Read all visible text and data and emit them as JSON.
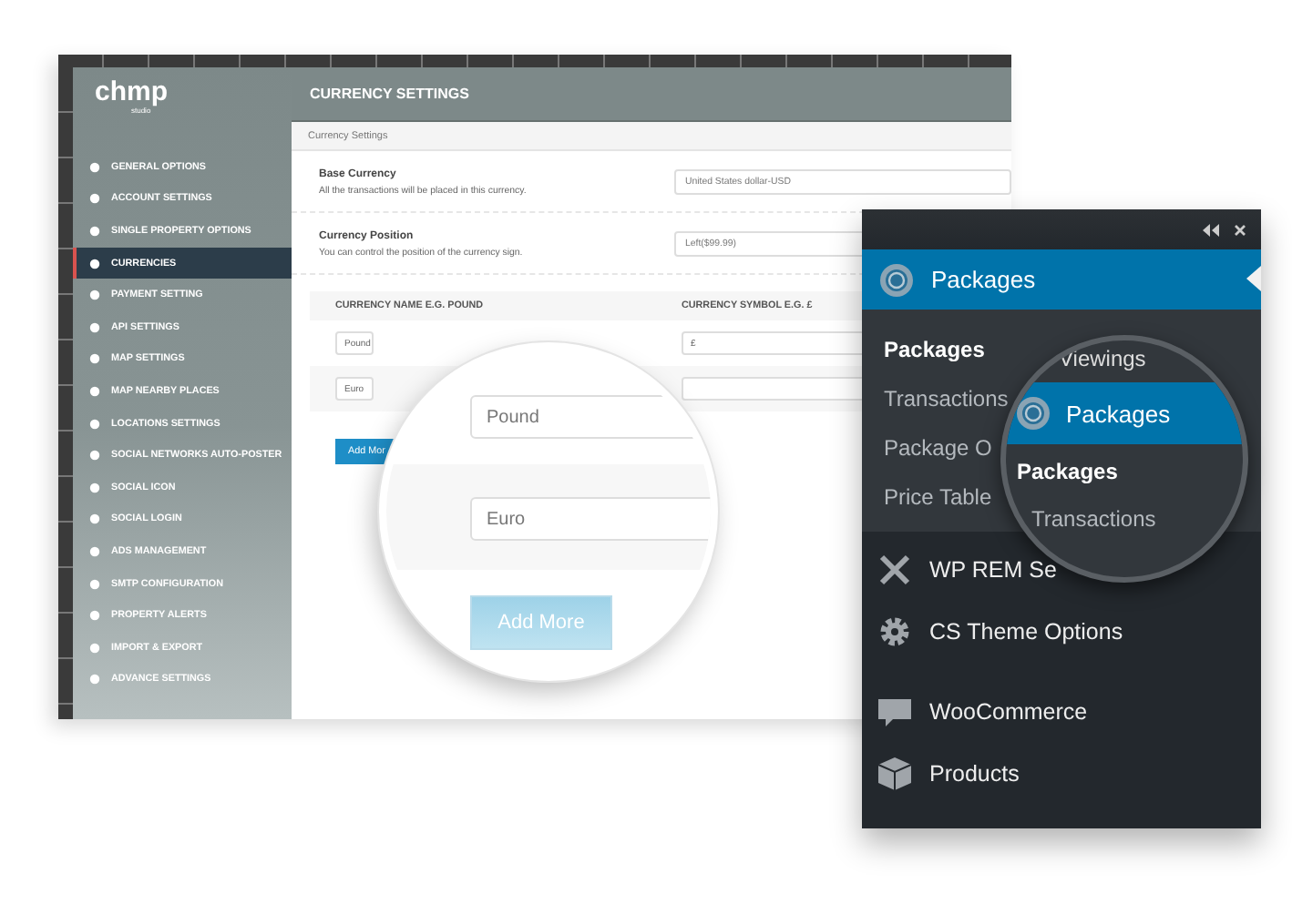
{
  "settings_window": {
    "logo": "chmp",
    "logo_sub": "studio",
    "sidebar": {
      "items": [
        {
          "label": "GENERAL OPTIONS",
          "selected": false
        },
        {
          "label": "ACCOUNT SETTINGS",
          "selected": false
        },
        {
          "label": "SINGLE PROPERTY OPTIONS",
          "selected": false
        },
        {
          "label": "CURRENCIES",
          "selected": true
        },
        {
          "label": "PAYMENT SETTING",
          "selected": false
        },
        {
          "label": "API SETTINGS",
          "selected": false
        },
        {
          "label": "MAP SETTINGS",
          "selected": false
        },
        {
          "label": "MAP NEARBY PLACES",
          "selected": false
        },
        {
          "label": "LOCATIONS SETTINGS",
          "selected": false
        },
        {
          "label": "SOCIAL NETWORKS AUTO-POSTER",
          "selected": false
        },
        {
          "label": "SOCIAL ICON",
          "selected": false
        },
        {
          "label": "SOCIAL LOGIN",
          "selected": false
        },
        {
          "label": "ADS MANAGEMENT",
          "selected": false
        },
        {
          "label": "SMTP CONFIGURATION",
          "selected": false
        },
        {
          "label": "PROPERTY ALERTS",
          "selected": false
        },
        {
          "label": "IMPORT & EXPORT",
          "selected": false
        },
        {
          "label": "ADVANCE SETTINGS",
          "selected": false
        }
      ]
    },
    "header": "CURRENCY SETTINGS",
    "section_tab": "Currency Settings",
    "fields": [
      {
        "label": "Base Currency",
        "description": "All the transactions will be placed in this currency.",
        "value": "United States dollar-USD"
      },
      {
        "label": "Currency Position",
        "description": "You can control the position of the currency sign.",
        "value": "Left($99.99)"
      }
    ],
    "table": {
      "columns": [
        "CURRENCY NAME E.G. POUND",
        "CURRENCY SYMBOL E.G. £"
      ],
      "rows": [
        {
          "name": "Pound",
          "symbol": "£"
        },
        {
          "name": "Euro"
        }
      ]
    },
    "add_button": "Add Mor"
  },
  "magnifier_left": {
    "fields": [
      "Pound",
      "Euro"
    ],
    "button": "Add More"
  },
  "admin_menu": {
    "active": {
      "label": "Packages",
      "selected": true
    },
    "submenu": [
      {
        "label": "Packages",
        "current": true
      },
      {
        "label": "Transactions",
        "current": false
      },
      {
        "label": "Package O",
        "current": false
      },
      {
        "label": "Price Table",
        "current": false
      }
    ],
    "items": [
      {
        "label": "WP REM Se",
        "kind": "tools"
      },
      {
        "label": "CS Theme Options",
        "kind": "gear"
      },
      {
        "label": "WooCommerce",
        "kind": "bubble"
      },
      {
        "label": "Products",
        "kind": "box"
      }
    ]
  },
  "magnifier_right": {
    "above": "Viewings",
    "active": "Packages",
    "submenu": [
      {
        "label": "Packages",
        "current": true
      },
      {
        "label": "Transactions",
        "current": false
      }
    ]
  }
}
